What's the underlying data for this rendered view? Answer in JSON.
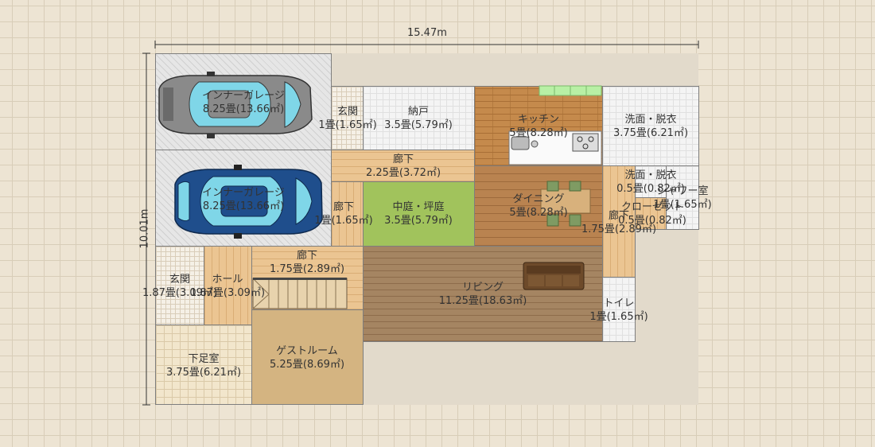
{
  "dimensions": {
    "width": "15.47m",
    "height": "10.01m"
  },
  "rooms": {
    "garage1": {
      "name": "インナーガレージ",
      "size": "8.25畳(13.66㎡)"
    },
    "garage2": {
      "name": "インナーガレージ",
      "size": "8.25畳(13.66㎡)"
    },
    "genkan1": {
      "name": "玄関",
      "size": "1畳(1.65㎡)"
    },
    "nando": {
      "name": "納戸",
      "size": "3.5畳(5.79㎡)"
    },
    "kitchen": {
      "name": "キッチン",
      "size": "5畳(8.28㎡)"
    },
    "senmen1": {
      "name": "洗面・脱衣",
      "size": "3.75畳(6.21㎡)"
    },
    "rouka1": {
      "name": "廊下",
      "size": "2.25畳(3.72㎡)"
    },
    "rouka2": {
      "name": "廊下",
      "size": "1畳(1.65㎡)"
    },
    "nakaniwa": {
      "name": "中庭・坪庭",
      "size": "3.5畳(5.79㎡)"
    },
    "dining": {
      "name": "ダイニング",
      "size": "5畳(8.28㎡)"
    },
    "senmen2": {
      "name": "洗面・脱衣",
      "size": "0.5畳(0.82㎡)"
    },
    "shower": {
      "name": "シャワー室",
      "size": "1畳(1.65㎡)"
    },
    "closet": {
      "name": "クローゼット",
      "size": "0.5畳(0.82㎡)"
    },
    "rouka3": {
      "name": "廊下",
      "size": "1.75畳(2.89㎡)"
    },
    "rouka4": {
      "name": "廊下",
      "size": "1.75畳(2.89㎡)"
    },
    "genkan2": {
      "name": "玄関",
      "size": "1.87畳(3.09㎡)"
    },
    "hall": {
      "name": "ホール",
      "size": "1.87畳(3.09㎡)"
    },
    "living": {
      "name": "リビング",
      "size": "11.25畳(18.63㎡)"
    },
    "toilet": {
      "name": "トイレ",
      "size": "1畳(1.65㎡)"
    },
    "geshitsu": {
      "name": "下足室",
      "size": "3.75畳(6.21㎡)"
    },
    "guest": {
      "name": "ゲストルーム",
      "size": "5.25畳(8.69㎡)"
    }
  },
  "colors": {
    "car_grey": "#8a8a8a",
    "car_blue": "#1f4e8c",
    "glass": "#7fd6e8"
  }
}
